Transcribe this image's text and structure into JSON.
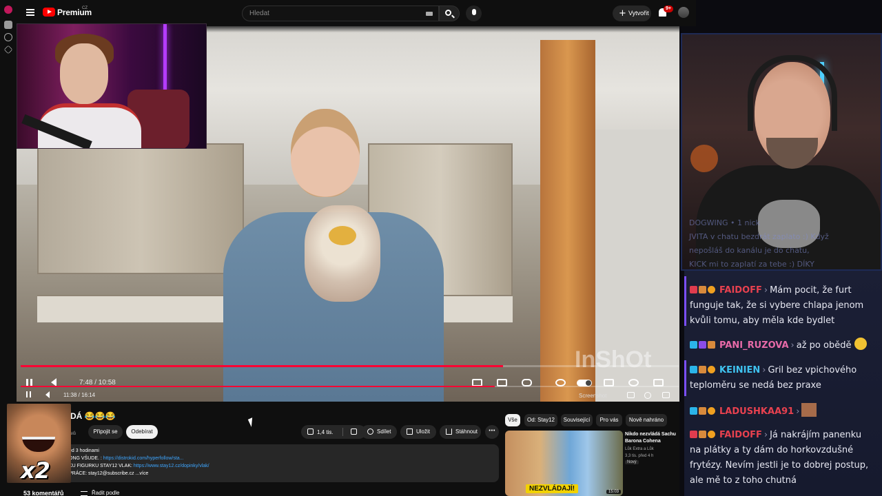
{
  "header": {
    "brand": "Premium",
    "brand_region": "CZ",
    "search_placeholder": "Hledat",
    "create_label": "Vytvořit",
    "notifications_badge": "9+"
  },
  "video": {
    "watermark": "InShOt",
    "stream_player": {
      "time": "7:48 / 10:58",
      "progress_fraction": 0.733
    },
    "player": {
      "time": "11:38 / 16:14",
      "progress_fraction": 0.72,
      "screenshot_label": "Screenshot"
    }
  },
  "below": {
    "title": "DÁ 😂😂😂",
    "channel_sub": "elů",
    "join_label": "Připojit se",
    "subscribe_label": "Odebírat",
    "like_count": "1,4 tis.",
    "share_label": "Sdílet",
    "save_label": "Uložit",
    "download_label": "Stáhnout",
    "more_label": "⋯",
    "description": {
      "line1": "ed 3 hodinami",
      "line2_prefix": "ONG VŠUDE.   : ",
      "line2_link": "https://distrokid.com/hyperfollow/sta...",
      "line3_prefix": "KU FIGURKU STAY12 VLAK: ",
      "line3_link": "https://www.stay12.cz/dopinky/vlak/",
      "line4_prefix": "PRÁCE: stay12@subscribe.cz",
      "line4_more": "...více"
    },
    "comments_label": "53 komentářů",
    "sort_label": "Řadit podle"
  },
  "recommendations": {
    "chips": [
      "Vše",
      "Od: Stay12",
      "Související",
      "Pro vás",
      "Nově nahráno"
    ],
    "item": {
      "title": "Nikdo nezvládá Sachu Barona Cohena",
      "channel": "Lůk Extra a Lůk",
      "stats": "3,3 tis.   před 4 h",
      "badge": "Nový",
      "banner": "NEZVLÁDAJÍ!",
      "duration": "15:03"
    }
  },
  "chat": {
    "faded": [
      "DOGWING • 1 nick",
      "JVITA v chatu bezdrát zaplato :) Když",
      "nepošláš do kanálu je do chatu,",
      "KICK mi to zaplatí za tebe :) DÍKY"
    ],
    "messages": [
      {
        "user": "FAIDOFF",
        "color": "#e8414f",
        "text_lines": [
          "Mám pocit, že furt",
          "funguje tak, že si vybere chlapa jenom",
          "kvůli tomu, aby měla kde bydlet"
        ]
      },
      {
        "user": "PANI_RUZOVA",
        "color": "#e86aa8",
        "text_lines": [
          "až po obědě"
        ]
      },
      {
        "user": "KEINIEN",
        "color": "#3fc3f0",
        "text_lines": [
          "Gril bez vpichového",
          "teploměru se nedá bez praxe"
        ]
      },
      {
        "user": "LADUSHKAA91",
        "color": "#e8414f",
        "text_lines": [
          ""
        ]
      },
      {
        "user": "FAIDOFF",
        "color": "#e8414f",
        "text_lines": [
          "Já nakrájím panenku",
          "na plátky a ty dám do horkovzdušné",
          "frytézy. Nevím jestli je to dobrej postup,",
          "ale mě to z toho chutná"
        ]
      }
    ]
  },
  "meme": {
    "caption": "x2"
  }
}
